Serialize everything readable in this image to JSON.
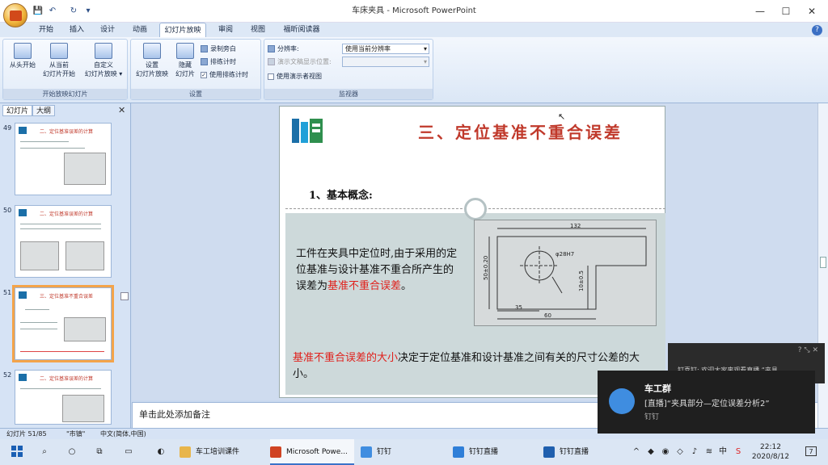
{
  "window": {
    "title": "车床夹具 - Microsoft PowerPoint",
    "controls": {
      "minimize": "—",
      "maximize": "☐",
      "close": "✕"
    },
    "qat": {
      "save": "💾",
      "undo": "↶",
      "redo": "↻",
      "more": "▾"
    }
  },
  "ribbon": {
    "tabs": [
      "开始",
      "插入",
      "设计",
      "动画",
      "幻灯片放映",
      "审阅",
      "视图",
      "福昕阅读器"
    ],
    "active_tab": "幻灯片放映",
    "help": "?",
    "group_start": {
      "label": "开始放映幻灯片",
      "from_beginning": "从头开始",
      "from_current_1": "从当前",
      "from_current_2": "幻灯片开始",
      "custom_1": "自定义",
      "custom_2": "幻灯片放映 ▾"
    },
    "group_setup": {
      "label": "设置",
      "setup_1": "设置",
      "setup_2": "幻灯片放映",
      "hide_1": "隐藏",
      "hide_2": "幻灯片",
      "record": "录制旁白",
      "rehearse": "排练计时",
      "use_timings": "使用排练计时"
    },
    "group_monitor": {
      "label": "监视器",
      "resolution_label": "分辨率:",
      "resolution_value": "使用当前分辨率",
      "show_on_label": "演示文稿显示位置:",
      "show_on_value": "",
      "presenter_view": "使用演示者视图"
    }
  },
  "leftpane": {
    "tab_slides": "幻灯片",
    "tab_outline": "大纲",
    "close": "✕",
    "thumbs": [
      {
        "num": "49",
        "title": "二、定位基准误差的计算"
      },
      {
        "num": "50",
        "title": "二、定位基准误差的计算"
      },
      {
        "num": "51",
        "title": "三、定位基准不重合误差"
      },
      {
        "num": "52",
        "title": "二、定位基准误差的计算"
      }
    ]
  },
  "slide": {
    "title": "三、定位基准不重合误差",
    "subtitle": "1、基本概念:",
    "body_black": "工件在夹具中定位时,由于采用的定位基准与设计基准不重合所产生的误差为",
    "body_red": "基准不重合误差",
    "body_end": "。",
    "foot_red": "基准不重合误差的大小",
    "foot_black": "决定于定位基准和设计基准之间有关的尺寸公差的大小。",
    "drawing": {
      "dim_top": "132",
      "dim_hole": "φ28H7",
      "dim_left": "50±0.20",
      "dim_right": "10±0.5",
      "dim_bottom1": "35",
      "dim_bottom2": "60"
    }
  },
  "notes_placeholder": "单击此处添加备注",
  "status": {
    "slide_count": "幻灯片 51/85",
    "theme": "\"市镇\"",
    "language": "中文(简体,中国)"
  },
  "toast_back": {
    "text": "钉喜钉: 欢迎大家来观看直播,“夹具"
  },
  "toast": {
    "app": "车工群",
    "message": "[直播]“夹具部分—定位误差分析2”",
    "source": "钉钉"
  },
  "taskbar": {
    "items": [
      "车工培训课件",
      "Microsoft Powe...",
      "钉钉",
      "钉钉直播",
      "钉钉直播"
    ],
    "tray_icons": [
      "^",
      "中",
      "S"
    ],
    "time": "22:12",
    "date": "2020/8/12",
    "notification_count": "7"
  },
  "colors": {
    "accent": "#c0392b",
    "highlight_red": "#e0201b",
    "ribbon_bg": "#dbe7f6",
    "band": "#cdd9da"
  }
}
